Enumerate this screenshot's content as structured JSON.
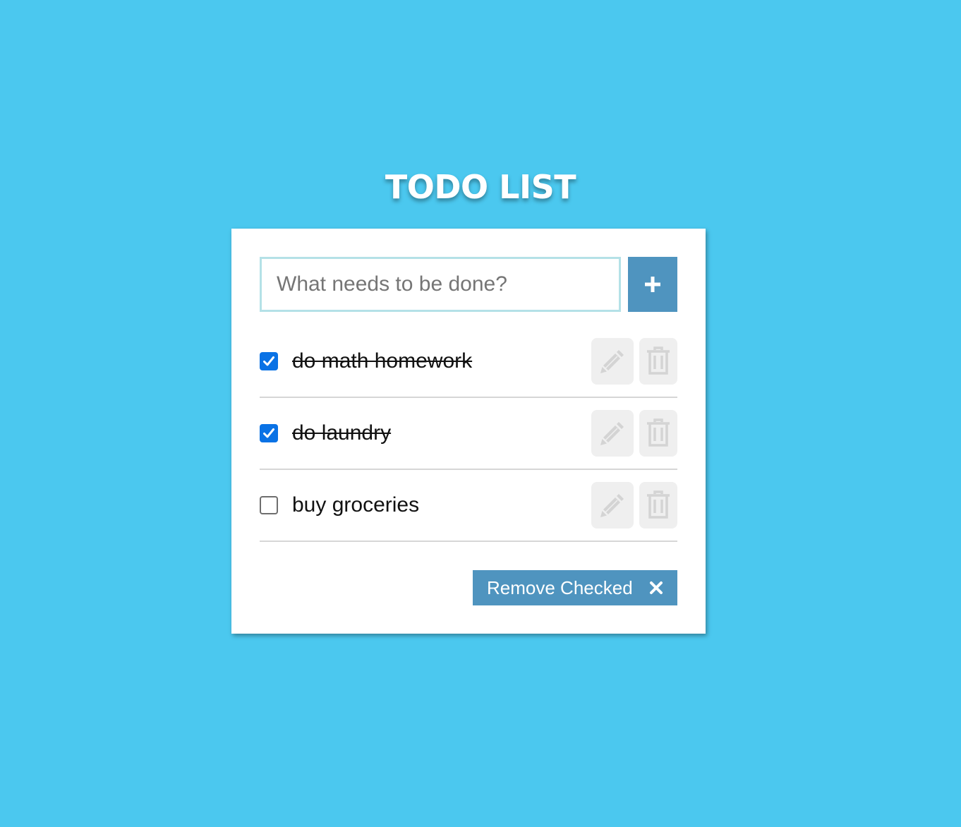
{
  "app": {
    "title": "TODO LIST"
  },
  "input": {
    "placeholder": "What needs to be done?",
    "value": ""
  },
  "add_button": {
    "label": "+",
    "icon": "plus-icon"
  },
  "todos": [
    {
      "text": "do math homework",
      "checked": true
    },
    {
      "text": "do laundry",
      "checked": true
    },
    {
      "text": "buy groceries",
      "checked": false
    }
  ],
  "footer": {
    "remove_label": "Remove Checked",
    "remove_icon": "close-icon"
  },
  "colors": {
    "background": "#4bc8ef",
    "accent": "#4f94bf",
    "checkbox": "#0a72e5",
    "input_border": "#b4e1e7",
    "action_bg": "#efefef",
    "action_icon": "#d4d4d4"
  }
}
